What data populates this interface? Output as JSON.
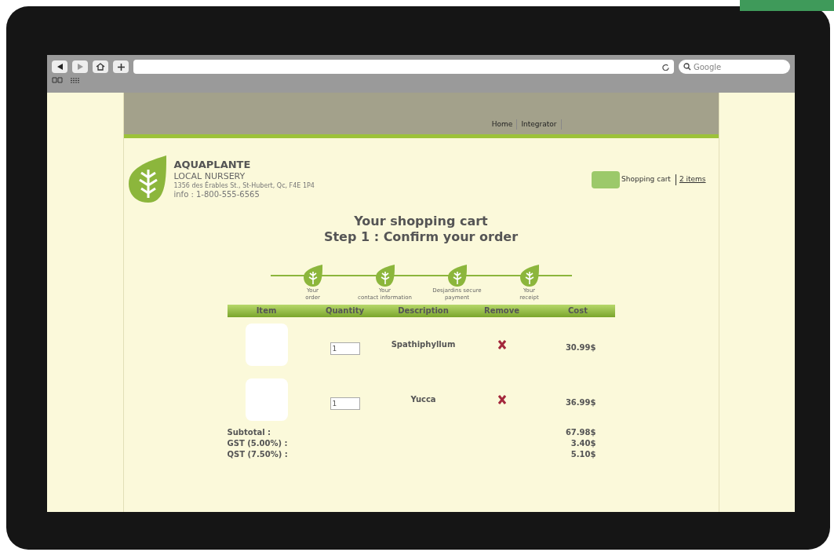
{
  "browser": {
    "search_placeholder": "Google"
  },
  "nav": [
    {
      "label": "Home"
    },
    {
      "label": "Integrator"
    }
  ],
  "brand": {
    "name": "AQUAPLANTE",
    "tagline": "LOCAL NURSERY",
    "address": "1356 des Érables St., St-Hubert, Qc, F4E 1P4",
    "phone": "info : 1-800-555-6565"
  },
  "cart_link": {
    "label": "Shopping cart",
    "count": "2 items"
  },
  "heading": [
    "Your shopping cart",
    "Step 1 : Confirm your order"
  ],
  "steps": [
    {
      "label": "Your\norder"
    },
    {
      "label": "Your\ncontact information"
    },
    {
      "label": "Desjardins secure\npayment"
    },
    {
      "label": "Your\nreceipt"
    }
  ],
  "table": {
    "columns": [
      "Item",
      "Quantity",
      "Description",
      "Remove",
      "Cost"
    ],
    "rows": [
      {
        "quantity": "1",
        "description": "Spathiphyllum",
        "cost": "30.99$"
      },
      {
        "quantity": "1",
        "description": "Yucca",
        "cost": "36.99$"
      }
    ]
  },
  "totals": [
    {
      "label": "Subtotal :",
      "value": "67.98$"
    },
    {
      "label": "GST (5.00%) :",
      "value": "3.40$"
    },
    {
      "label": "QST (7.50%) :",
      "value": "5.10$"
    }
  ]
}
